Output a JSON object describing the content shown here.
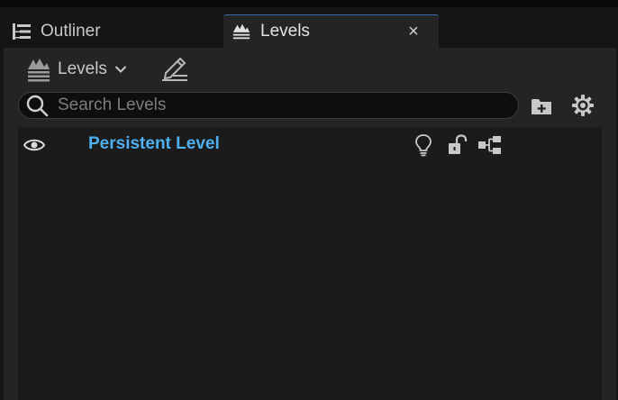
{
  "tabs": [
    {
      "label": "Outliner",
      "icon": "outliner-icon",
      "active": false
    },
    {
      "label": "Levels",
      "icon": "levels-icon",
      "active": true,
      "close_glyph": "×"
    }
  ],
  "toolbar": {
    "levels_menu_label": "Levels",
    "levels_menu_icon": "levels-icon",
    "edit_icon": "edit-pencil-icon"
  },
  "search": {
    "placeholder": "Search Levels",
    "value": ""
  },
  "levels": [
    {
      "name": "Persistent Level",
      "visible": true,
      "locked": false
    }
  ],
  "colors": {
    "accent": "#4fb0f0",
    "panel_bg": "#242424",
    "list_bg": "#1a1a1a"
  }
}
